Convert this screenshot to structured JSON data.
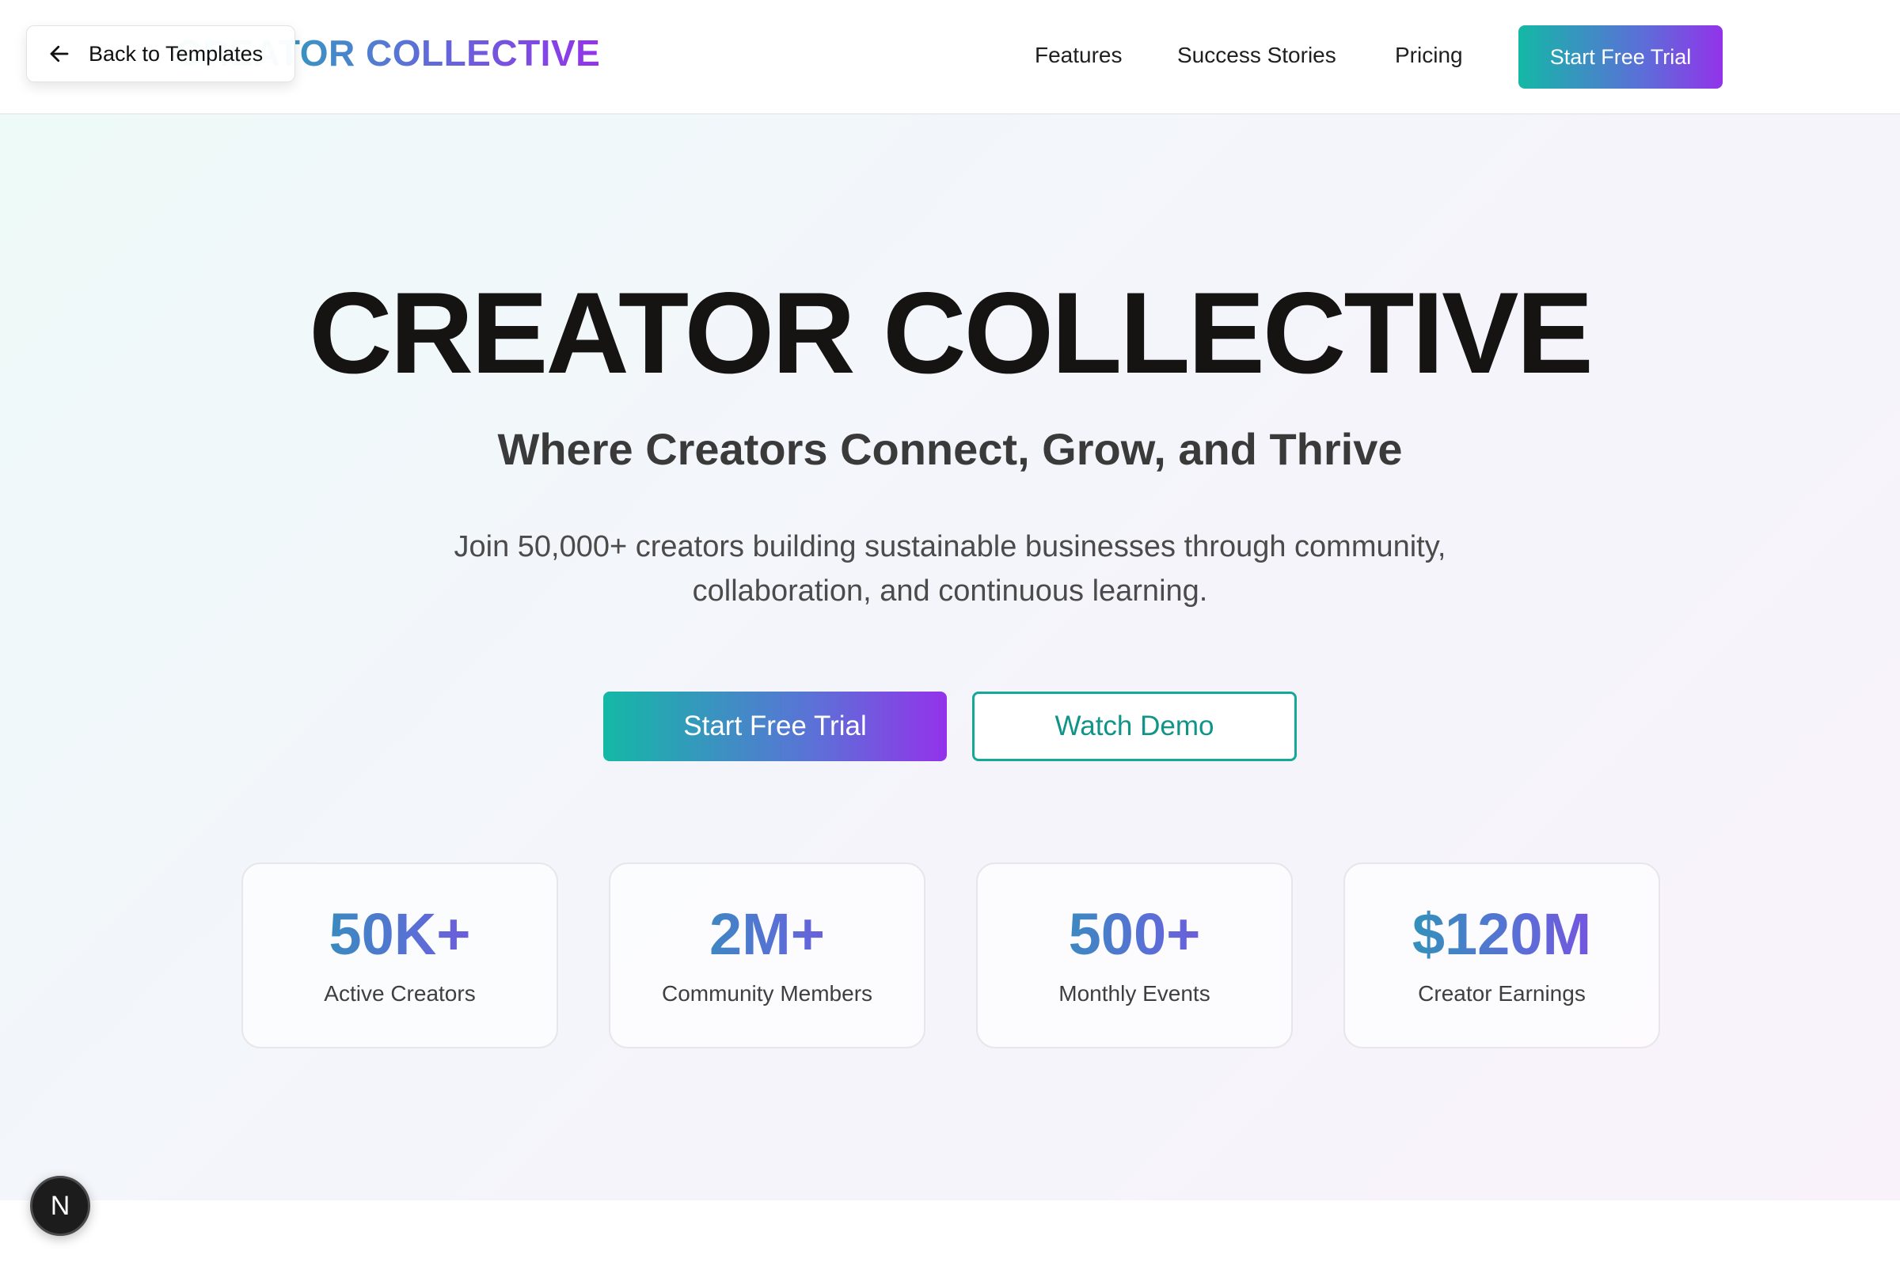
{
  "header": {
    "brand": "CREATOR COLLECTIVE",
    "nav": [
      {
        "label": "Features"
      },
      {
        "label": "Success Stories"
      },
      {
        "label": "Pricing"
      }
    ],
    "cta_label": "Start Free Trial"
  },
  "back_pill": {
    "label": "Back to Templates",
    "icon": "arrow-left-icon"
  },
  "hero": {
    "title": "CREATOR COLLECTIVE",
    "subtitle": "Where Creators Connect, Grow, and Thrive",
    "description": "Join 50,000+ creators building sustainable businesses through community, collaboration, and continuous learning.",
    "primary_button": "Start Free Trial",
    "secondary_button": "Watch Demo"
  },
  "stats": [
    {
      "value": "50K+",
      "label": "Active Creators"
    },
    {
      "value": "2M+",
      "label": "Community Members"
    },
    {
      "value": "500+",
      "label": "Monthly Events"
    },
    {
      "value": "$120M",
      "label": "Creator Earnings"
    }
  ],
  "badge": {
    "letter": "N",
    "icon": "nextjs-logo-icon"
  },
  "colors": {
    "accent_teal": "#14b8a6",
    "accent_purple": "#9333ea",
    "text_dark": "#161412"
  }
}
